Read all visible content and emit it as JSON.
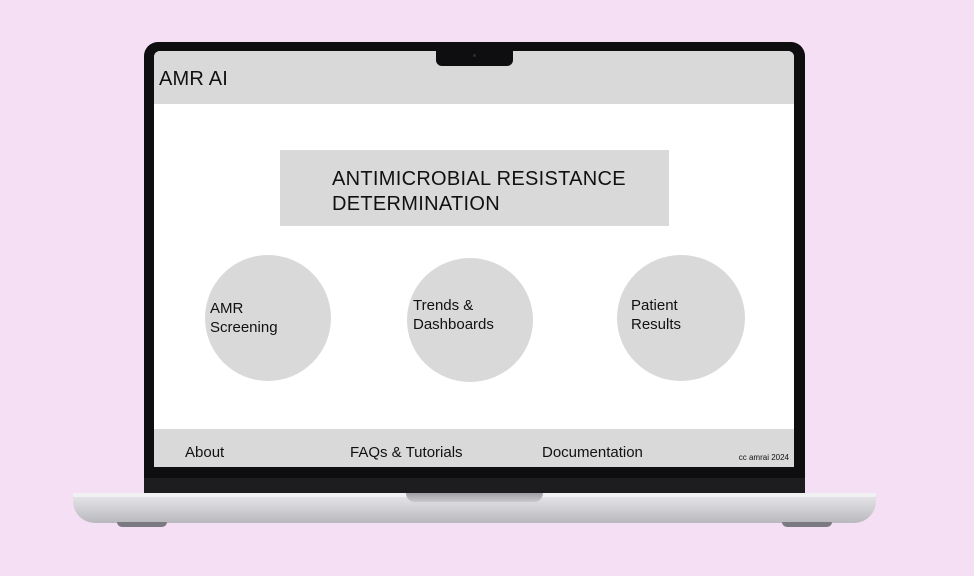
{
  "header": {
    "title": "AMR AI"
  },
  "hero": {
    "title": "ANTIMICROBIAL RESISTANCE\nDETERMINATION"
  },
  "tiles": [
    {
      "label": "AMR\nScreening"
    },
    {
      "label": "Trends &\nDashboards"
    },
    {
      "label": "Patient\nResults"
    }
  ],
  "footer": {
    "links": [
      "About",
      "FAQs & Tutorials",
      "Documentation"
    ],
    "copyright": "cc amrai 2024"
  },
  "colors": {
    "background": "#f5dff5",
    "panel": "#d9d9d9",
    "screen": "#ffffff",
    "bezel": "#0e0e10"
  }
}
